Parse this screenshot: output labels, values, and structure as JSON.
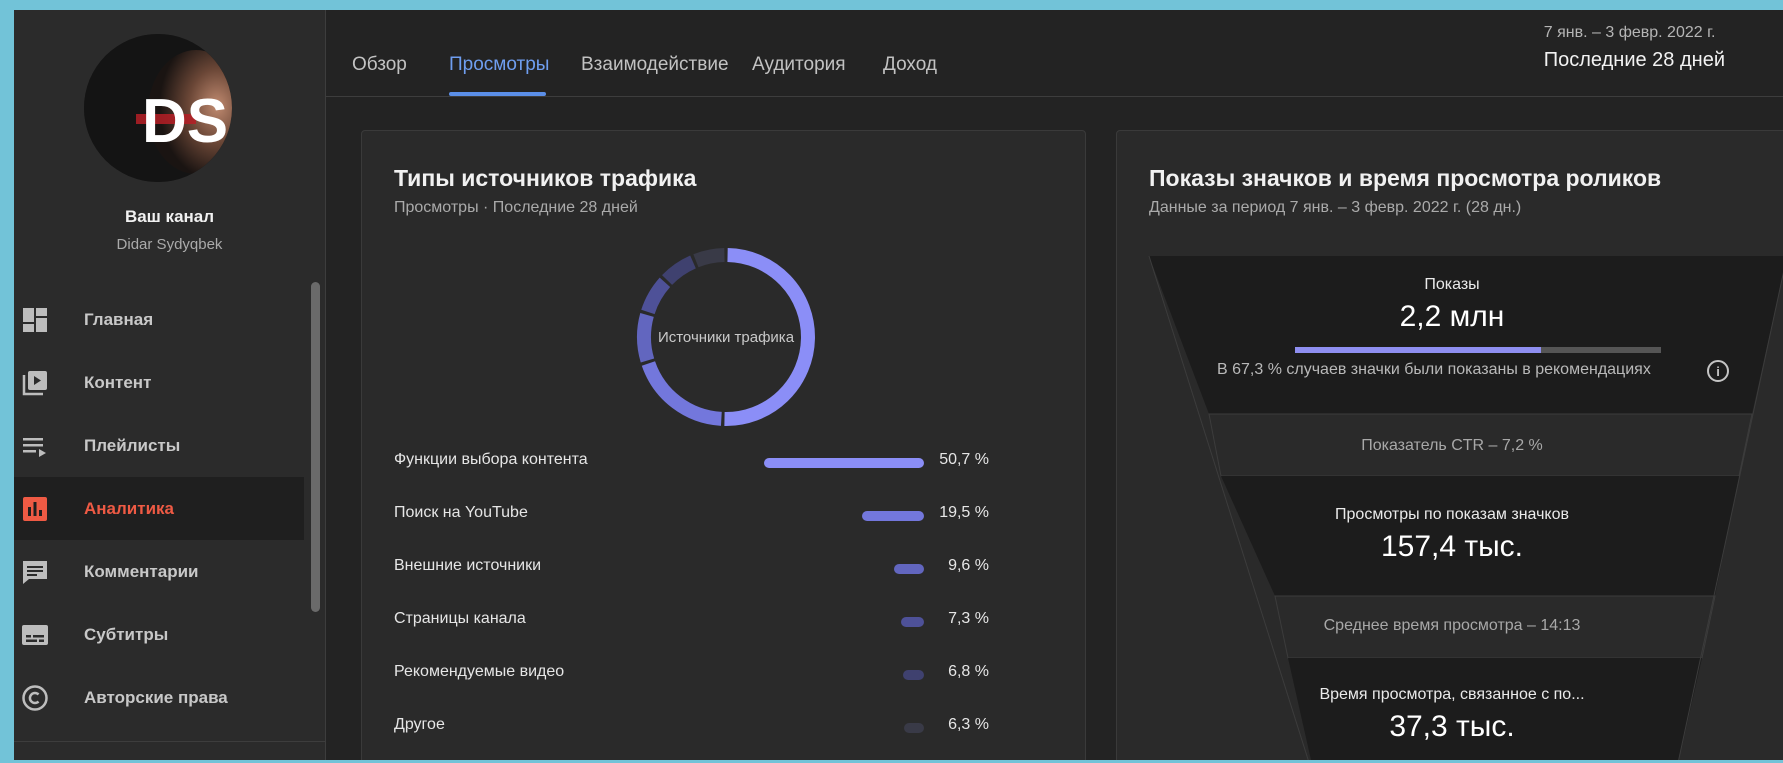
{
  "sidebar": {
    "channel_title": "Ваш канал",
    "channel_name": "Didar Sydyqbek",
    "avatar_logo": "DS",
    "items": [
      {
        "label": "Главная",
        "icon": "dashboard-icon",
        "active": false
      },
      {
        "label": "Контент",
        "icon": "video-library-icon",
        "active": false
      },
      {
        "label": "Плейлисты",
        "icon": "playlist-icon",
        "active": false
      },
      {
        "label": "Аналитика",
        "icon": "analytics-icon",
        "active": true
      },
      {
        "label": "Комментарии",
        "icon": "comment-icon",
        "active": false
      },
      {
        "label": "Субтитры",
        "icon": "subtitles-icon",
        "active": false
      },
      {
        "label": "Авторские права",
        "icon": "copyright-icon",
        "active": false
      }
    ]
  },
  "header": {
    "tabs": [
      {
        "label": "Обзор",
        "active": false
      },
      {
        "label": "Просмотры",
        "active": true
      },
      {
        "label": "Взаимодействие",
        "active": false
      },
      {
        "label": "Аудитория",
        "active": false
      },
      {
        "label": "Доход",
        "active": false
      }
    ],
    "date_range": "7 янв. – 3 февр. 2022 г.",
    "period": "Последние 28 дней"
  },
  "traffic_card": {
    "title": "Типы источников трафика",
    "subtitle": "Просмотры · Последние 28 дней",
    "donut_label": "Источники трафика",
    "sources": [
      {
        "name": "Функции выбора контента",
        "percent_label": "50,7 %",
        "value": 50.7
      },
      {
        "name": "Поиск на YouTube",
        "percent_label": "19,5 %",
        "value": 19.5
      },
      {
        "name": "Внешние источники",
        "percent_label": "9,6 %",
        "value": 9.6
      },
      {
        "name": "Страницы канала",
        "percent_label": "7,3 %",
        "value": 7.3
      },
      {
        "name": "Рекомендуемые видео",
        "percent_label": "6,8 %",
        "value": 6.8
      },
      {
        "name": "Другое",
        "percent_label": "6,3 %",
        "value": 6.3
      }
    ],
    "colors": [
      "#8b8ef7",
      "#7377dc",
      "#6266bf",
      "#4e5198",
      "#3f416f",
      "#393a47"
    ]
  },
  "funnel_card": {
    "title": "Показы значков и время просмотра роликов",
    "subtitle": "Данные за период 7 янв. – 3 февр. 2022 г. (28 дн.)",
    "impressions_label": "Показы",
    "impressions_value": "2,2 млн",
    "impressions_share": 0.673,
    "impressions_note": "В 67,3 % случаев значки были показаны в рекомендациях",
    "ctr_text": "Показатель CTR – 7,2 %",
    "views_label": "Просмотры по показам значков",
    "views_value": "157,4 тыс.",
    "avg_text": "Среднее время просмотра – 14:13",
    "watch_label": "Время просмотра, связанное с по...",
    "watch_value": "37,3 тыс."
  },
  "colors": {
    "accent_red": "#ee5a44",
    "tab_active": "#6f9ef0",
    "bar_purple": "#8e8ef0"
  }
}
